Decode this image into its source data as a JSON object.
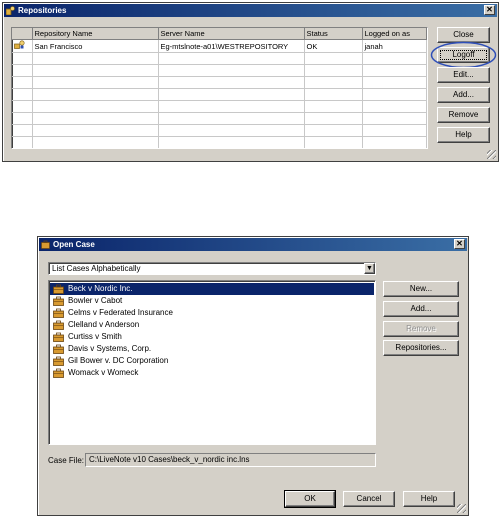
{
  "repositories_dialog": {
    "title": "Repositories",
    "columns": [
      "",
      "Repository Name",
      "Server Name",
      "Status",
      "Logged on as"
    ],
    "rows": [
      {
        "icon": "repository-user-icon",
        "name": "San Francisco",
        "server": "Eg-mtslnote-a01\\WESTREPOSITORY",
        "status": "OK",
        "logged_on_as": "janah"
      }
    ],
    "empty_row_count": 8,
    "buttons": {
      "close": "Close",
      "logoff": "Logoff",
      "edit": "Edit...",
      "add": "Add...",
      "remove": "Remove",
      "help": "Help"
    },
    "highlight_color": "#2f4fb8"
  },
  "open_case_dialog": {
    "title": "Open Case",
    "sort_select_value": "List Cases Alphabetically",
    "cases": [
      "Beck v Nordic Inc.",
      "Bowler v Cabot",
      "Celms v Federated Insurance",
      "Clelland v Anderson",
      "Curtiss v Smith",
      "Davis v Systems, Corp.",
      "Gil Bower v. DC Corporation",
      "Womack v Womeck"
    ],
    "selected_index": 0,
    "side_buttons": {
      "new": "New...",
      "add": "Add...",
      "remove": "Remove",
      "repositories": "Repositories..."
    },
    "case_file_label": "Case File:",
    "case_file_value": "C:\\LiveNote v10 Cases\\beck_v_nordic inc.lns",
    "bottom_buttons": {
      "ok": "OK",
      "cancel": "Cancel",
      "help": "Help"
    },
    "selection_color": "#0a246a"
  }
}
